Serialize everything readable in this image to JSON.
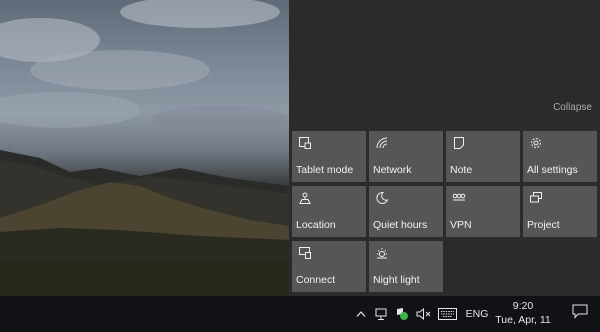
{
  "action_center": {
    "collapse_label": "Collapse",
    "tiles": [
      {
        "label": "Tablet mode",
        "icon": "tablet-mode-icon"
      },
      {
        "label": "Network",
        "icon": "network-icon"
      },
      {
        "label": "Note",
        "icon": "note-icon"
      },
      {
        "label": "All settings",
        "icon": "gear-icon"
      },
      {
        "label": "Location",
        "icon": "location-icon"
      },
      {
        "label": "Quiet hours",
        "icon": "moon-icon"
      },
      {
        "label": "VPN",
        "icon": "vpn-icon"
      },
      {
        "label": "Project",
        "icon": "project-icon"
      },
      {
        "label": "Connect",
        "icon": "connect-icon"
      },
      {
        "label": "Night light",
        "icon": "sun-icon"
      }
    ]
  },
  "taskbar": {
    "tray_icons": [
      "chevron-up-icon",
      "network-icon",
      "defender-icon",
      "volume-muted-icon",
      "keyboard-icon"
    ],
    "language": "ENG",
    "time": "9:20",
    "date": "Tue, Apr, 11"
  },
  "colors": {
    "panel_bg": "#2b2b2b",
    "tile_bg": "#565656",
    "taskbar_bg": "#111215",
    "defender_green": "#3bb54a"
  }
}
